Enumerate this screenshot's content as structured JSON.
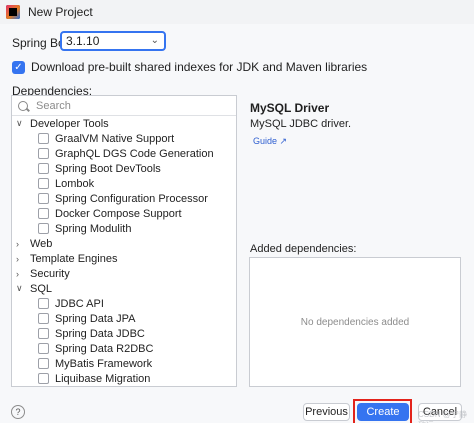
{
  "window": {
    "title": "New Project"
  },
  "spring_boot": {
    "label": "Spring Boot:",
    "value": "3.1.10"
  },
  "download_indexes": {
    "label": "Download pre-built shared indexes for JDK and Maven libraries",
    "checked": true
  },
  "dependencies": {
    "label": "Dependencies:",
    "search_placeholder": "Search",
    "tree": [
      {
        "label": "Developer Tools",
        "expanded": true,
        "items": [
          "GraalVM Native Support",
          "GraphQL DGS Code Generation",
          "Spring Boot DevTools",
          "Lombok",
          "Spring Configuration Processor",
          "Docker Compose Support",
          "Spring Modulith"
        ]
      },
      {
        "label": "Web",
        "expanded": false,
        "items": []
      },
      {
        "label": "Template Engines",
        "expanded": false,
        "items": []
      },
      {
        "label": "Security",
        "expanded": false,
        "items": []
      },
      {
        "label": "SQL",
        "expanded": true,
        "items": [
          "JDBC API",
          "Spring Data JPA",
          "Spring Data JDBC",
          "Spring Data R2DBC",
          "MyBatis Framework",
          "Liquibase Migration"
        ]
      }
    ]
  },
  "selected_dependency": {
    "title": "MySQL Driver",
    "description": "MySQL JDBC driver.",
    "guide_link": "Guide ↗"
  },
  "added_dependencies": {
    "label": "Added dependencies:",
    "empty_text": "No dependencies added"
  },
  "buttons": {
    "help": "?",
    "previous": "Previous",
    "create": "Create",
    "cancel": "Cancel"
  },
  "watermark": "CSDN @宁静致远",
  "colors": {
    "accent": "#3574f0",
    "highlight": "#e3231b",
    "link": "#2f5fd0"
  }
}
